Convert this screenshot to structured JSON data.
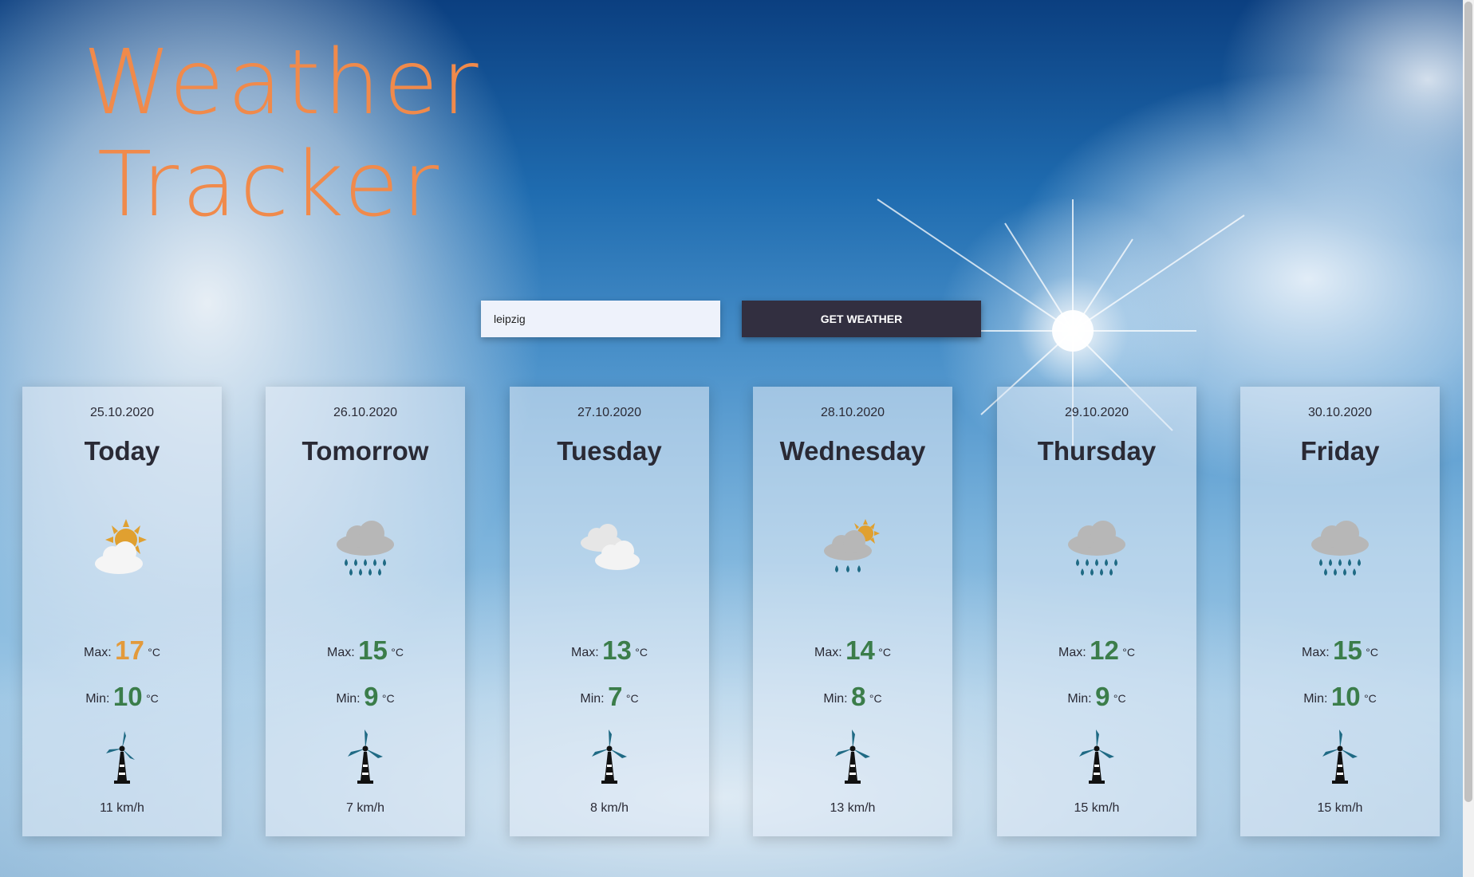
{
  "app": {
    "title_line1": "Weather",
    "title_line2": "Tracker",
    "title_color": "#f08a4b"
  },
  "search": {
    "value": "leipzig",
    "button_label": "GET WEATHER"
  },
  "days": [
    {
      "date": "25.10.2020",
      "day": "Today",
      "icon": "sun-cloud-icon",
      "max": "17",
      "min": "10",
      "wind": "11 km/h",
      "max_color": "#e39a3b"
    },
    {
      "date": "26.10.2020",
      "day": "Tomorrow",
      "icon": "rain-cloud-icon",
      "max": "15",
      "min": "9",
      "wind": "7 km/h"
    },
    {
      "date": "27.10.2020",
      "day": "Tuesday",
      "icon": "clouds-icon",
      "max": "13",
      "min": "7",
      "wind": "8 km/h"
    },
    {
      "date": "28.10.2020",
      "day": "Wednesday",
      "icon": "sun-rain-icon",
      "max": "14",
      "min": "8",
      "wind": "13 km/h"
    },
    {
      "date": "29.10.2020",
      "day": "Thursday",
      "icon": "rain-cloud-icon",
      "max": "12",
      "min": "9",
      "wind": "15 km/h"
    },
    {
      "date": "30.10.2020",
      "day": "Friday",
      "icon": "rain-cloud-icon",
      "max": "15",
      "min": "10",
      "wind": "15 km/h"
    }
  ],
  "labels": {
    "max": "Max:",
    "min": "Min:",
    "unit": "°C"
  },
  "colors": {
    "button_bg": "#322f40",
    "temp_green": "#3b7d4a",
    "temp_warm": "#e39a3b",
    "rain_drop": "#1f6a84",
    "turbine": "#1f6a84"
  }
}
